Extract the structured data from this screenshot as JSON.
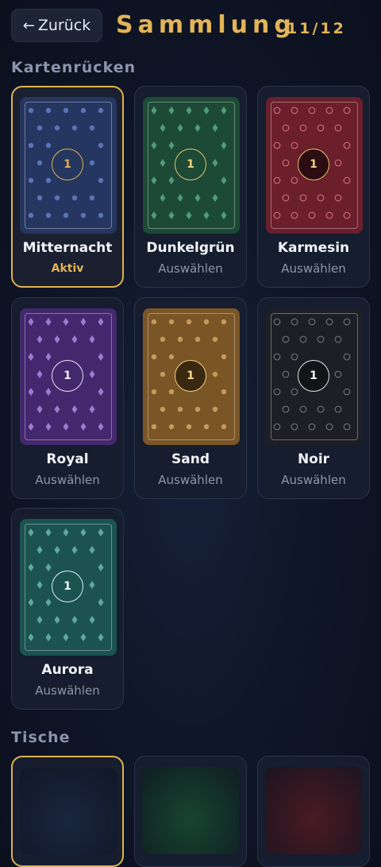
{
  "header": {
    "back_label": "Zurück",
    "back_arrow": "←",
    "title": "Sammlung",
    "counter": "11/12"
  },
  "sections": {
    "card_backs": "Kartenrücken",
    "tables": "Tische"
  },
  "card_backs": [
    {
      "name": "Mitternacht",
      "status": "Aktiv",
      "active": true,
      "badge": "1",
      "pattern": "dot",
      "bg": "#253660",
      "accent": "#5a74b5",
      "badge_bg": "#253660",
      "badge_border": "#e0b24e",
      "badge_text": "#e0b24e"
    },
    {
      "name": "Dunkelgrün",
      "status": "Auswählen",
      "active": false,
      "badge": "1",
      "pattern": "diamond",
      "bg": "#1d4a36",
      "accent": "#4f9c78",
      "badge_bg": "#1d4a36",
      "badge_border": "#e6c46a",
      "badge_text": "#f0d27a"
    },
    {
      "name": "Karmesin",
      "status": "Auswählen",
      "active": false,
      "badge": "1",
      "pattern": "ring",
      "bg": "#6a1f2b",
      "accent": "#c86a77",
      "badge_bg": "#2c0d12",
      "badge_border": "#e8c36a",
      "badge_text": "#f0d27a"
    },
    {
      "name": "Royal",
      "status": "Auswählen",
      "active": false,
      "badge": "1",
      "pattern": "diamond",
      "bg": "#43286e",
      "accent": "#9c7ad0",
      "badge_bg": "#43286e",
      "badge_border": "#e9e4f2",
      "badge_text": "#f1ecf8"
    },
    {
      "name": "Sand",
      "status": "Auswählen",
      "active": false,
      "badge": "1",
      "pattern": "dot",
      "bg": "#7a5526",
      "accent": "#c59a5c",
      "badge_bg": "#3a2810",
      "badge_border": "#f0d48a",
      "badge_text": "#f3d991"
    },
    {
      "name": "Noir",
      "status": "Auswählen",
      "active": false,
      "badge": "1",
      "pattern": "ring",
      "bg": "#1d1f24",
      "accent": "#6a6f78",
      "badge_bg": "#131417",
      "badge_border": "#e4e6ea",
      "badge_text": "#f1f2f4"
    },
    {
      "name": "Aurora",
      "status": "Auswählen",
      "active": false,
      "badge": "1",
      "pattern": "diamond",
      "bg": "#1c5350",
      "accent": "#5fa8a0",
      "badge_bg": "#1c5350",
      "badge_border": "#d9f0ee",
      "badge_text": "#e9f8f6"
    }
  ],
  "tables": [
    {
      "active": true,
      "felt": "#1a2640"
    },
    {
      "active": false,
      "felt": "#174530"
    },
    {
      "active": false,
      "felt": "#4a1a24"
    }
  ]
}
